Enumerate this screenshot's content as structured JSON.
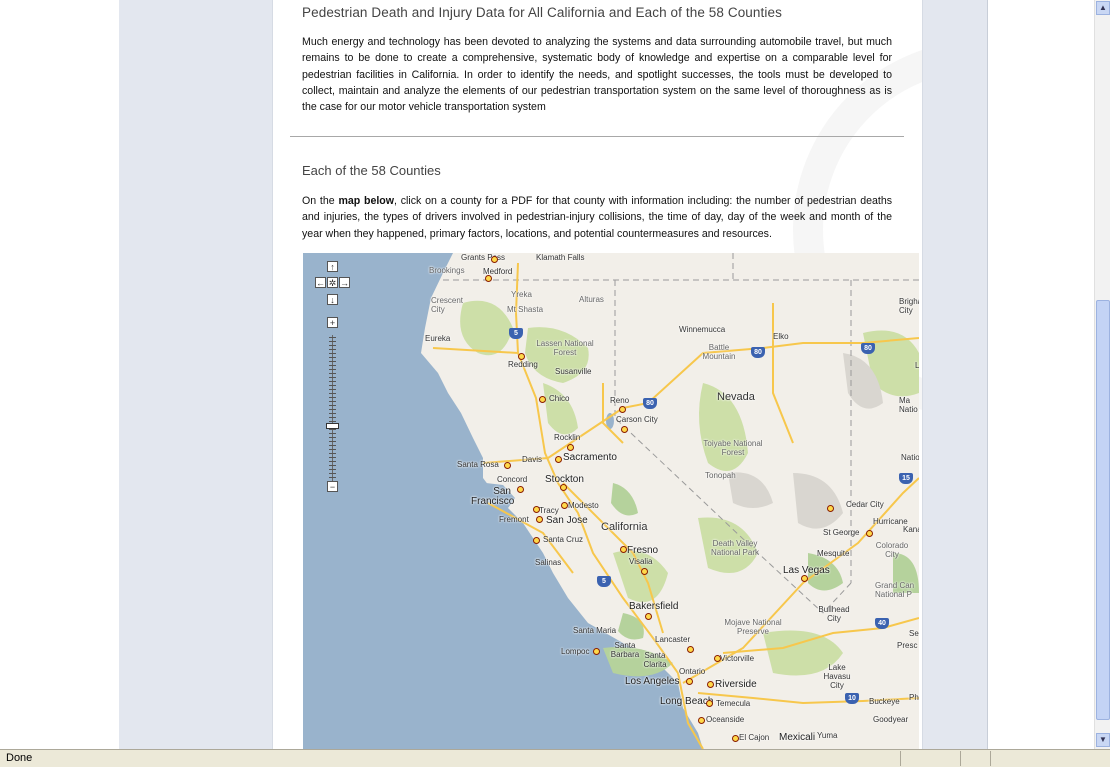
{
  "page": {
    "heading": "Pedestrian Death and Injury Data for All California and Each of the 58 Counties",
    "intro": "Much energy and technology has been devoted to analyzing the systems and data surrounding automobile travel, but much remains to be done to create a comprehensive, systematic body of knowledge and expertise on a comparable level for pedestrian facilities in California. In order to identify the needs, and spotlight successes, the tools must be developed to collect, maintain and analyze the elements of our pedestrian transportation system on the same level of thoroughness as is the case for our motor vehicle transportation system",
    "section_heading": "Each of the 58 Counties",
    "instructions_prefix": "On the ",
    "instructions_bold": "map below",
    "instructions_suffix": ", click on a county for a PDF for that county with information including: the number of pedestrian deaths and injuries, the types of drivers involved in pedestrian-injury collisions, the time of day, day of the week and month of the year when they happened, primary factors, locations, and potential countermeasures and resources."
  },
  "map": {
    "controls": {
      "pan_up": "↑",
      "pan_left": "←",
      "pan_center": "✲",
      "pan_right": "→",
      "pan_down": "↓",
      "zoom_in": "+",
      "zoom_out": "−",
      "zoom_level": 0.62
    },
    "labels": {
      "grants_pass": "Grants Pass",
      "klamath_falls": "Klamath Falls",
      "brookings": "Brookings",
      "medford": "Medford",
      "crescent_city": "Crescent City",
      "yreka": "Yreka",
      "mt_shasta": "Mt Shasta",
      "alturas": "Alturas",
      "eureka": "Eureka",
      "lassen": "Lassen National Forest",
      "redding": "Redding",
      "susanville": "Susanville",
      "winnemucca": "Winnemucca",
      "elko": "Elko",
      "battle_mountain": "Battle Mountain",
      "brigham_city": "Brigha City",
      "chico": "Chico",
      "reno": "Reno",
      "carson_city": "Carson City",
      "nevada": "Nevada",
      "rocklin": "Rocklin",
      "davis": "Davis",
      "sacramento": "Sacramento",
      "toiyabe": "Toiyabe National Forest",
      "santa_rosa": "Santa Rosa",
      "concord": "Concord",
      "stockton": "Stockton",
      "tonopah": "Tonopah",
      "san_francisco": "San Francisco",
      "tracy": "Tracy",
      "modesto": "Modesto",
      "fremont": "Fremont",
      "san_jose": "San Jose",
      "california": "California",
      "cedar_city": "Cedar City",
      "hurricane": "Hurricane",
      "st_george": "St George",
      "santa_cruz": "Santa Cruz",
      "fresno": "Fresno",
      "death_valley": "Death Valley National Park",
      "colorado_city": "Colorado City",
      "mesquite": "Mesquite",
      "salinas": "Salinas",
      "visalia": "Visalia",
      "las_vegas": "Las Vegas",
      "grand_canyon": "Grand Can National P",
      "bakersfield": "Bakersfield",
      "bullhead": "Bullhead City",
      "santa_maria": "Santa Maria",
      "mojave": "Mojave National Preserve",
      "lancaster": "Lancaster",
      "lompoc": "Lompoc",
      "santa_barbara": "Santa Barbara",
      "santa_clarita": "Santa Clarita",
      "victorville": "Victorville",
      "lake_havasu": "Lake Havasu City",
      "ontario": "Ontario",
      "los_angeles": "Los Angeles",
      "riverside": "Riverside",
      "long_beach": "Long Beach",
      "temecula": "Temecula",
      "buckeye": "Buckeye",
      "oceanside": "Oceanside",
      "goodyear": "Goodyear",
      "el_cajon": "El Cajon",
      "mexicali": "Mexicali",
      "yuma": "Yuma",
      "ma_nation": "Ma Natio",
      "natio": "Natio",
      "presc": "Presc",
      "kanab": "Kanab",
      "se": "Se",
      "l": "L",
      "ph": "Ph"
    },
    "shields": {
      "i5_north": "5",
      "i5_south": "5",
      "i80_reno": "80",
      "i80_battle": "80",
      "i80_east": "80",
      "i15": "15",
      "i40": "40",
      "i10": "10"
    },
    "colors": {
      "ocean": "#99b3cc",
      "land": "#f2efe9",
      "forest": "#cddfa8",
      "park": "#b5d29c",
      "desert": "#d9d6d0",
      "highway": "#f7c74c",
      "border": "#9a9a9a"
    }
  },
  "statusbar": {
    "text": "Done"
  },
  "scrollbar": {
    "up": "▲",
    "down": "▼"
  }
}
